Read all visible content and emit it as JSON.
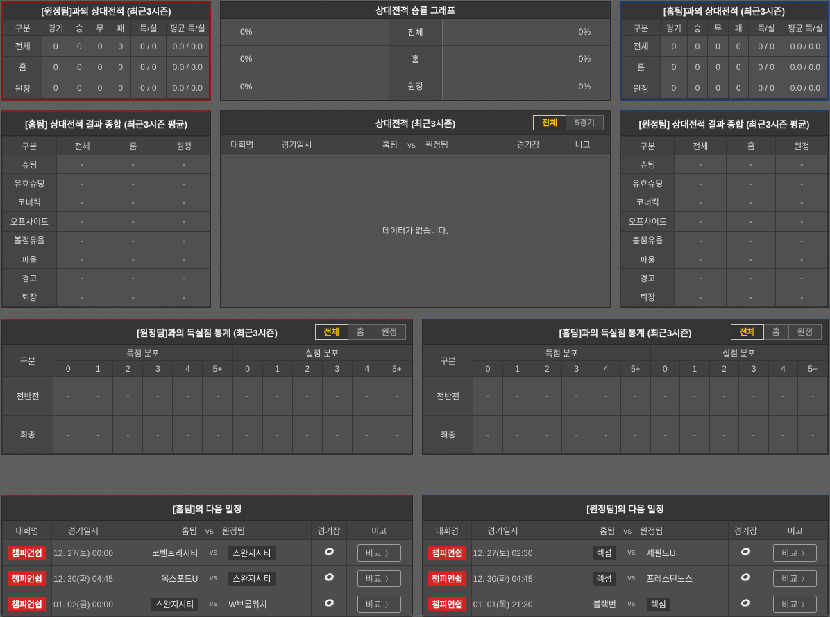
{
  "colors": {
    "accent_red": "#7d1d1d",
    "accent_blue": "#1e3c74",
    "badge_red": "#d32424",
    "tab_active_text": "#ffc400"
  },
  "h2h_away": {
    "title": "[원정팀]과의 상대전적 (최근3시즌)",
    "columns": [
      "구분",
      "경기",
      "승",
      "무",
      "패",
      "득/실",
      "평균 득/실"
    ],
    "rows": [
      {
        "label": "전체",
        "values": [
          "0",
          "0",
          "0",
          "0",
          "0 / 0",
          "0.0 / 0.0"
        ]
      },
      {
        "label": "홈",
        "values": [
          "0",
          "0",
          "0",
          "0",
          "0 / 0",
          "0.0 / 0.0"
        ]
      },
      {
        "label": "원정",
        "values": [
          "0",
          "0",
          "0",
          "0",
          "0 / 0",
          "0.0 / 0.0"
        ]
      }
    ]
  },
  "graph": {
    "title": "상대전적 승률 그래프",
    "rows": [
      {
        "label": "전체",
        "left": "0%",
        "right": "0%"
      },
      {
        "label": "홈",
        "left": "0%",
        "right": "0%"
      },
      {
        "label": "원정",
        "left": "0%",
        "right": "0%"
      }
    ]
  },
  "h2h_home": {
    "title": "[홈팀]과의 상대전적 (최근3시즌)",
    "columns": [
      "구분",
      "경기",
      "승",
      "무",
      "패",
      "득/실",
      "평균 득/실"
    ],
    "rows": [
      {
        "label": "전체",
        "values": [
          "0",
          "0",
          "0",
          "0",
          "0 / 0",
          "0.0 / 0.0"
        ]
      },
      {
        "label": "홈",
        "values": [
          "0",
          "0",
          "0",
          "0",
          "0 / 0",
          "0.0 / 0.0"
        ]
      },
      {
        "label": "원정",
        "values": [
          "0",
          "0",
          "0",
          "0",
          "0 / 0",
          "0.0 / 0.0"
        ]
      }
    ]
  },
  "summary_home": {
    "title": "[홈팀] 상대전적 결과 종합 (최근3시즌 평균)",
    "columns": [
      "구분",
      "전체",
      "홈",
      "원정"
    ],
    "metrics": [
      "슈팅",
      "유효슈팅",
      "코너킥",
      "오프사이드",
      "볼점유율",
      "파울",
      "경고",
      "퇴장"
    ],
    "value": "-"
  },
  "summary_away": {
    "title": "[원정팀] 상대전적 결과 종합 (최근3시즌 평균)",
    "columns": [
      "구분",
      "전체",
      "홈",
      "원정"
    ],
    "metrics": [
      "슈팅",
      "유효슈팅",
      "코너킥",
      "오프사이드",
      "볼점유율",
      "파울",
      "경고",
      "퇴장"
    ],
    "value": "-"
  },
  "h2h_list": {
    "title": "상대전적 (최근3시즌)",
    "tabs": [
      {
        "label": "전체",
        "active": true
      },
      {
        "label": "5경기",
        "active": false
      }
    ],
    "columns": [
      "대회명",
      "경기일시",
      "경기장",
      "비고"
    ],
    "team_header": {
      "home": "홈팀",
      "vs": "vs",
      "away": "원정팀"
    },
    "empty": "데이터가 없습니다."
  },
  "goals_away": {
    "title": "[원정팀]과의 득실점 통계 (최근3시즌)",
    "tabs": [
      {
        "label": "전체",
        "active": true
      },
      {
        "label": "홈",
        "active": false
      },
      {
        "label": "원정",
        "active": false
      }
    ],
    "corner": "구분",
    "groups": [
      "득점 분포",
      "실점 분포"
    ],
    "bins": [
      "0",
      "1",
      "2",
      "3",
      "4",
      "5+"
    ],
    "rows": [
      "전반전",
      "최종"
    ],
    "value": "-"
  },
  "goals_home": {
    "title": "[홈팀]과의 득실점 통계 (최근3시즌)",
    "tabs": [
      {
        "label": "전체",
        "active": true
      },
      {
        "label": "홈",
        "active": false
      },
      {
        "label": "원정",
        "active": false
      }
    ],
    "corner": "구분",
    "groups": [
      "득점 분포",
      "실점 분포"
    ],
    "bins": [
      "0",
      "1",
      "2",
      "3",
      "4",
      "5+"
    ],
    "rows": [
      "전반전",
      "최종"
    ],
    "value": "-"
  },
  "sched_home": {
    "title": "[홈팀]의 다음 일정",
    "columns": [
      "대회명",
      "경기일시",
      "경기장",
      "비고"
    ],
    "team_header": {
      "home": "홈팀",
      "vs": "vs",
      "away": "원정팀"
    },
    "compare_label": "비교",
    "chevron": "〉",
    "rows": [
      {
        "league": "챔피언쉽",
        "datetime": "12. 27(토) 00:00",
        "home": "코벤트리시티",
        "away": "스완지시티",
        "highlight": "away"
      },
      {
        "league": "챔피언쉽",
        "datetime": "12. 30(화) 04:45",
        "home": "옥스포드U",
        "away": "스완지시티",
        "highlight": "away"
      },
      {
        "league": "챔피언쉽",
        "datetime": "01. 02(금) 00:00",
        "home": "스완지시티",
        "away": "W브롬위치",
        "highlight": "home"
      }
    ]
  },
  "sched_away": {
    "title": "[원정팀]의 다음 일정",
    "columns": [
      "대회명",
      "경기일시",
      "경기장",
      "비고"
    ],
    "team_header": {
      "home": "홈팀",
      "vs": "vs",
      "away": "원정팀"
    },
    "compare_label": "비교",
    "chevron": "〉",
    "rows": [
      {
        "league": "챔피언쉽",
        "datetime": "12. 27(토) 02:30",
        "home": "렉섬",
        "away": "셰필드U",
        "highlight": "home"
      },
      {
        "league": "챔피언쉽",
        "datetime": "12. 30(화) 04:45",
        "home": "렉섬",
        "away": "프레스턴노스",
        "highlight": "home"
      },
      {
        "league": "챔피언쉽",
        "datetime": "01. 01(목) 21:30",
        "home": "블랙번",
        "away": "렉섬",
        "highlight": "away"
      }
    ]
  }
}
